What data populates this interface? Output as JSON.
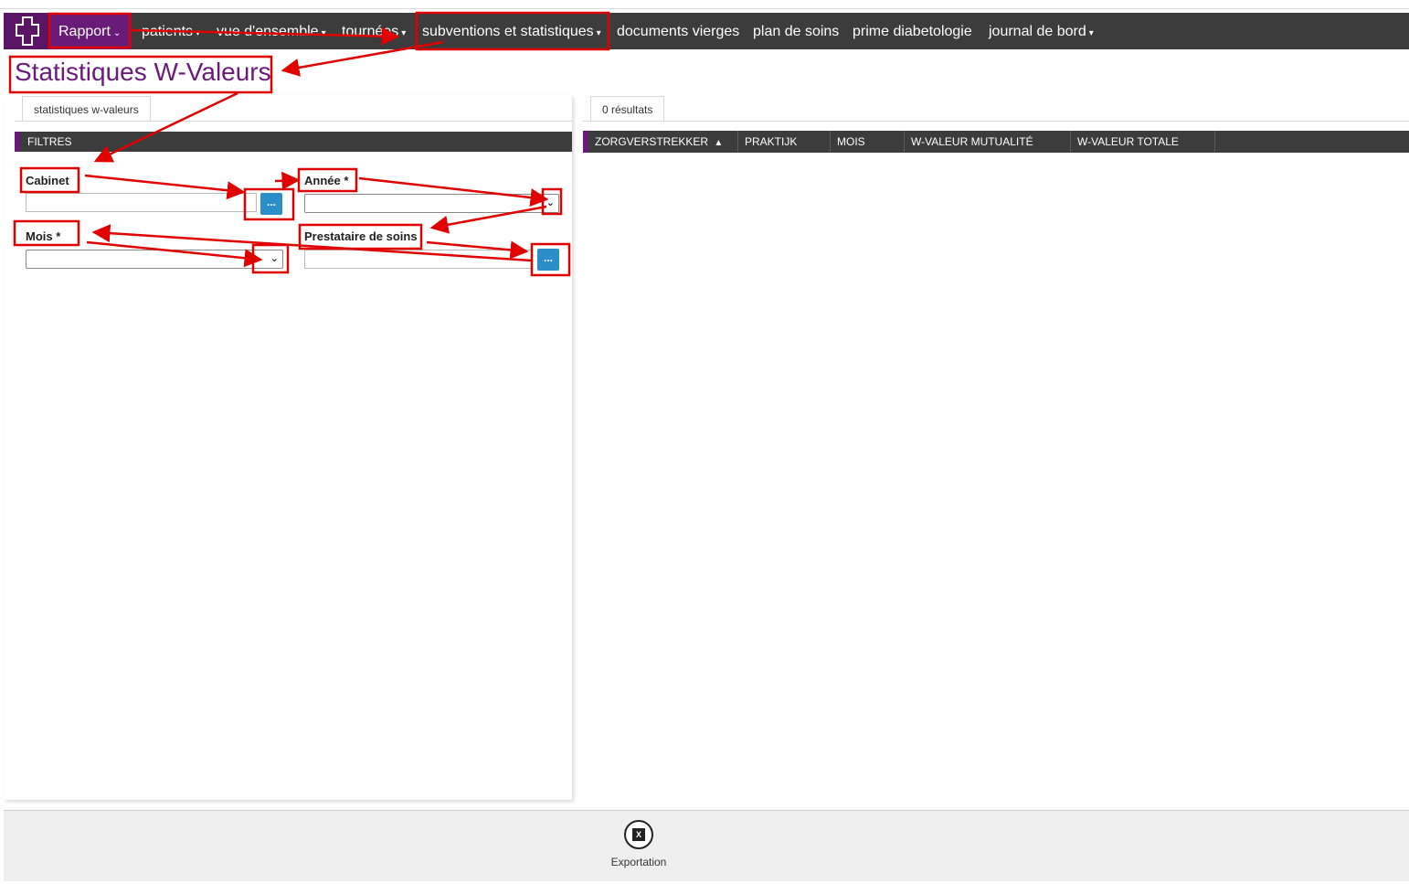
{
  "navbar": {
    "items": [
      {
        "label": "Rapport",
        "caret": "⌄"
      },
      {
        "label": "patients",
        "caret": "▾"
      },
      {
        "label": "vue d'ensemble",
        "caret": "▾"
      },
      {
        "label": "tournées",
        "caret": "▾"
      },
      {
        "label": "subventions et statistiques",
        "caret": "▾"
      },
      {
        "label": "documents vierges",
        "caret": ""
      },
      {
        "label": "plan de soins",
        "caret": ""
      },
      {
        "label": "prime diabetologie",
        "caret": ""
      },
      {
        "label": "journal de bord",
        "caret": "▾"
      }
    ],
    "logo_icon": "cross-logo-icon"
  },
  "page": {
    "title": "Statistiques W-Valeurs"
  },
  "left_panel": {
    "tab_label": "statistiques w-valeurs",
    "section_title": "FILTRES",
    "fields": {
      "cabinet": {
        "label": "Cabinet",
        "value": ""
      },
      "annee": {
        "label": "Année *",
        "value": ""
      },
      "mois": {
        "label": "Mois *",
        "value": ""
      },
      "prestataire": {
        "label": "Prestataire de soins",
        "value": ""
      }
    },
    "browse_button_label": "..."
  },
  "results": {
    "tab_label": "0 résultats",
    "columns": [
      {
        "label": "ZORGVERSTREKKER",
        "sort": "▲"
      },
      {
        "label": "PRAKTIJK",
        "sort": ""
      },
      {
        "label": "MOIS",
        "sort": ""
      },
      {
        "label": "W-VALEUR MUTUALITÉ",
        "sort": ""
      },
      {
        "label": "W-VALEUR TOTALE",
        "sort": ""
      }
    ]
  },
  "footer": {
    "export_label": "Exportation",
    "export_icon": "excel-icon",
    "export_icon_text": "X"
  },
  "colors": {
    "brand": "#6a1b7a",
    "nav_bg": "#3c3c3c",
    "button": "#2b8ec8",
    "annotation": "#e00000"
  }
}
